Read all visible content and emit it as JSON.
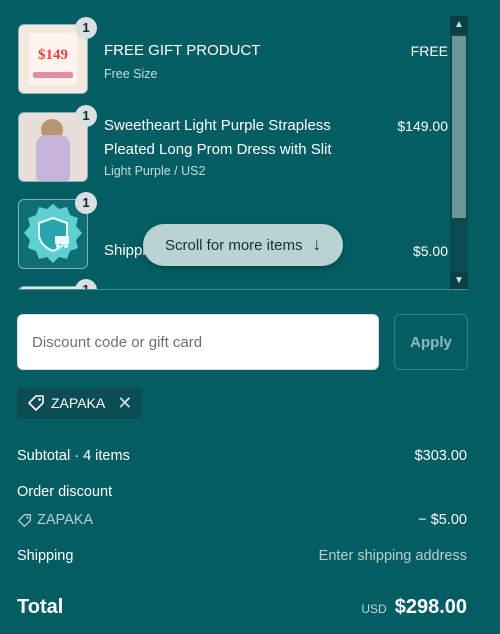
{
  "items": [
    {
      "name": "FREE GIFT PRODUCT",
      "variant": "Free Size",
      "price": "FREE",
      "quantity": "1",
      "thumb_text": "$149"
    },
    {
      "name": "Sweetheart Light Purple Strapless Pleated Long Prom Dress with Slit",
      "variant": "Light Purple / US2",
      "price": "$149.00",
      "quantity": "1"
    },
    {
      "name": "Shipping Protection",
      "variant": "",
      "price": "$5.00",
      "quantity": "1"
    },
    {
      "name": "",
      "variant": "",
      "price": "",
      "quantity": "1"
    }
  ],
  "scroll_hint": {
    "label": "Scroll for more items",
    "icon": "arrow-down-icon"
  },
  "discount": {
    "placeholder": "Discount code or gift card",
    "value": "",
    "apply_label": "Apply",
    "applied_code": "ZAPAKA"
  },
  "summary": {
    "subtotal_label": "Subtotal · 4 items",
    "subtotal_value": "$303.00",
    "order_discount_label": "Order discount",
    "order_discount_code": "ZAPAKA",
    "order_discount_value": "− $5.00",
    "shipping_label": "Shipping",
    "shipping_value": "Enter shipping address",
    "total_label": "Total",
    "currency": "USD",
    "total_value": "$298.00"
  },
  "colors": {
    "background": "#045d63",
    "pill": "#b9d3d3",
    "chip": "#0c4d53"
  }
}
